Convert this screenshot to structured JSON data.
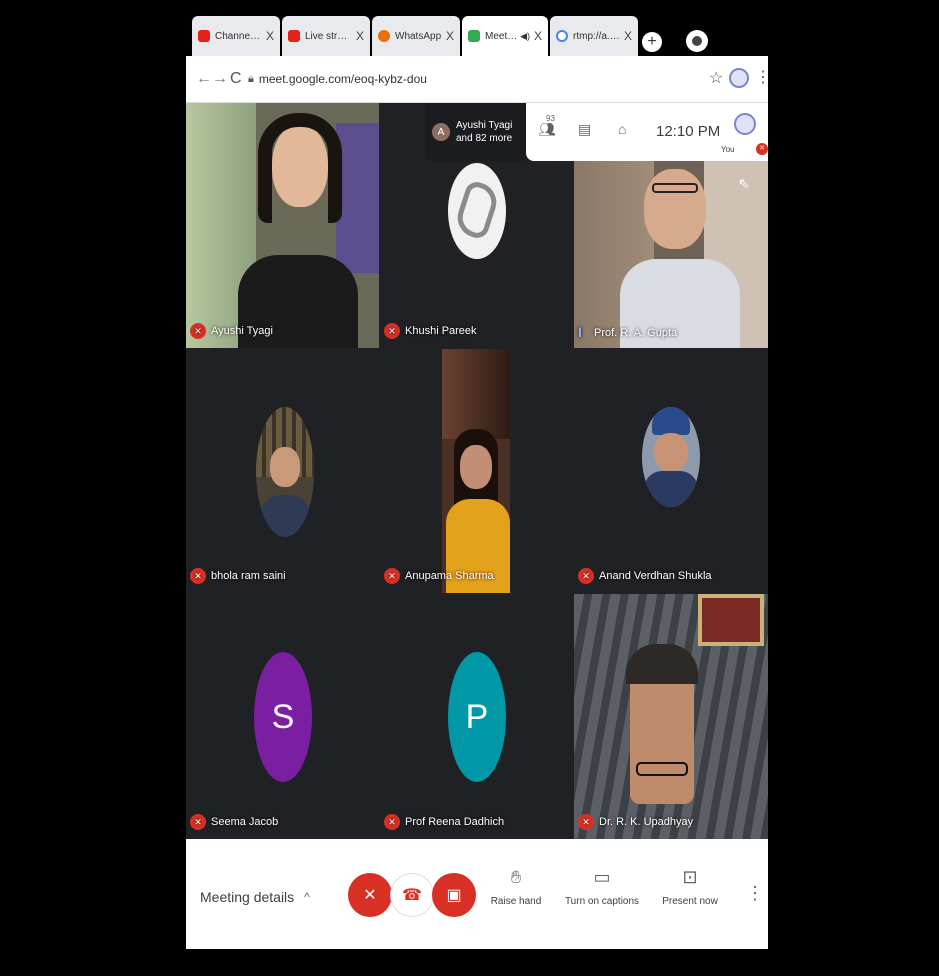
{
  "browser": {
    "tabs": [
      {
        "title": "Channel dashbo",
        "color": "#e62117",
        "active": false
      },
      {
        "title": "Live streaming -",
        "color": "#e62117",
        "active": false
      },
      {
        "title": "WhatsApp",
        "color": "#e8710a",
        "active": false
      },
      {
        "title": "Meet - eoq-",
        "color": "#34a853",
        "active": true
      },
      {
        "title": "rtmp://a.rtmp.yo",
        "color": "#4285f4",
        "active": false
      }
    ],
    "close_glyph": "X",
    "new_tab_glyph": "+",
    "url": "meet.google.com/eoq-kybz-dou"
  },
  "meet": {
    "top_info": {
      "avatar_letter": "A",
      "text_line1": "Ayushi Tyagi",
      "text_line2": "and 82 more"
    },
    "people_count": "93",
    "time": "12:10 PM",
    "you_label": "You",
    "participants": [
      {
        "name": "Ayushi Tyagi",
        "kind": "video",
        "muted": true
      },
      {
        "name": "Khushi Pareek",
        "kind": "avatar-photo",
        "muted": true
      },
      {
        "name": "Prof. R. A. Gupta",
        "kind": "video",
        "muted": false,
        "speaking": true
      },
      {
        "name": "bhola ram saini",
        "kind": "avatar-photo",
        "muted": true
      },
      {
        "name": "Anupama Sharma",
        "kind": "video",
        "muted": true
      },
      {
        "name": "Anand Verdhan Shukla",
        "kind": "avatar-photo",
        "muted": true
      },
      {
        "name": "Seema Jacob",
        "kind": "letter",
        "letter": "S",
        "color": "#7b1fa2",
        "muted": true
      },
      {
        "name": "Prof Reena Dadhich",
        "kind": "letter",
        "letter": "P",
        "color": "#0097a7",
        "muted": true
      },
      {
        "name": "Dr. R. K. Upadhyay",
        "kind": "video",
        "muted": true
      }
    ]
  },
  "controls": {
    "meeting_details": "Meeting details",
    "raise_hand": "Raise hand",
    "captions": "Turn on captions",
    "present": "Present now",
    "mic_color": "#d93025",
    "cam_color": "#d93025",
    "leave_color": "#d93025"
  }
}
